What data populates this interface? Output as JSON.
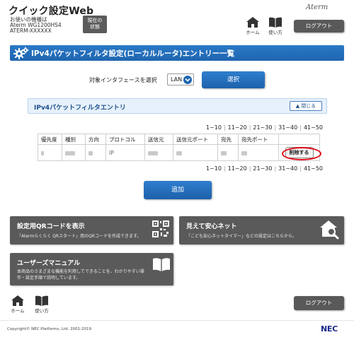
{
  "header": {
    "app_title": "クイック設定Web",
    "model_label": "お使いの機種は",
    "model_name": "Aterm WG1200HS4",
    "model_sn": "ATERM-XXXXXX",
    "status_button": "現在の\n状態",
    "brand_logo": "Aterm",
    "home_label": "ホーム",
    "manual_label": "使い方",
    "logout_label": "ログアウト"
  },
  "page": {
    "title": "IPv4パケットフィルタ設定(ローカルルータ)エントリー一覧"
  },
  "interface": {
    "label": "対象インタフェースを選択",
    "selected": "LAN",
    "select_button": "選択"
  },
  "panel": {
    "title": "IPv4パケットフィルタエントリ",
    "close_label": "閉じる"
  },
  "pager": [
    "1~10",
    "11~20",
    "21~30",
    "31~40",
    "41~50"
  ],
  "table": {
    "columns": [
      "優先度",
      "種別",
      "方向",
      "プロトコル",
      "送信元",
      "送信元ポート",
      "宛先",
      "宛先ポート",
      ""
    ],
    "rows": [
      {
        "protocol": "IP",
        "delete_label": "削除する"
      }
    ]
  },
  "add_button": "追加",
  "cards": {
    "qr": {
      "title": "設定用QRコードを表示",
      "desc": "「Atermらくらく QRスタート」用のQRコードを作成できます。"
    },
    "safety": {
      "title": "見えて安心ネット",
      "desc": "「こども安心ネットタイマー」などの設定はこちらから。"
    },
    "manual": {
      "title": "ユーザーズマニュアル",
      "desc1": "本商品のさまざまな機能を利用してできることを、わかりやすい操",
      "desc2": "作・設定手順で説明しています。"
    }
  },
  "footer": {
    "home_label": "ホーム",
    "manual_label": "使い方",
    "logout_label": "ログアウト",
    "copyright": "Copyright© NEC Platforms, Ltd. 2001-2019",
    "nec_logo": "NEC"
  },
  "colors": {
    "primary_blue": "#1f66b0",
    "dark_button": "#595959",
    "highlight_ring": "#e0101a"
  }
}
